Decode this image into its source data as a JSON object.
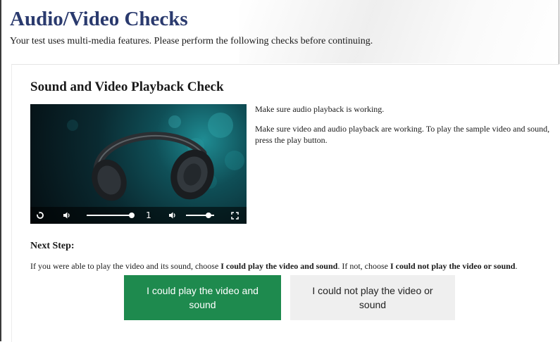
{
  "page": {
    "title": "Audio/Video Checks",
    "subtitle": "Your test uses multi-media features. Please perform the following checks before continuing."
  },
  "check": {
    "title": "Sound and Video Playback Check",
    "audio_note": "Make sure audio playback is working.",
    "video_note": "Make sure video and audio playback are working. To play the sample video and sound, press the play button."
  },
  "player": {
    "replay_icon": "replay-icon",
    "volume_icon": "volume-icon",
    "fullscreen_icon": "fullscreen-icon",
    "volume_level": 1.0,
    "speed_value": "1",
    "speed_volume_level": 0.8
  },
  "next_step": {
    "title": "Next Step:",
    "text_before": "If you were able to play the video and its sound, choose ",
    "yes_ref": "I could play the video and sound",
    "text_middle": ". If not, choose ",
    "no_ref": "I could not play the video or sound",
    "text_after": "."
  },
  "buttons": {
    "yes_label": "I could play the video and sound",
    "no_label": "I could not play the video or sound"
  },
  "colors": {
    "title": "#2a3a6e",
    "yes_button": "#1e8a4e",
    "no_button": "#efefef"
  }
}
